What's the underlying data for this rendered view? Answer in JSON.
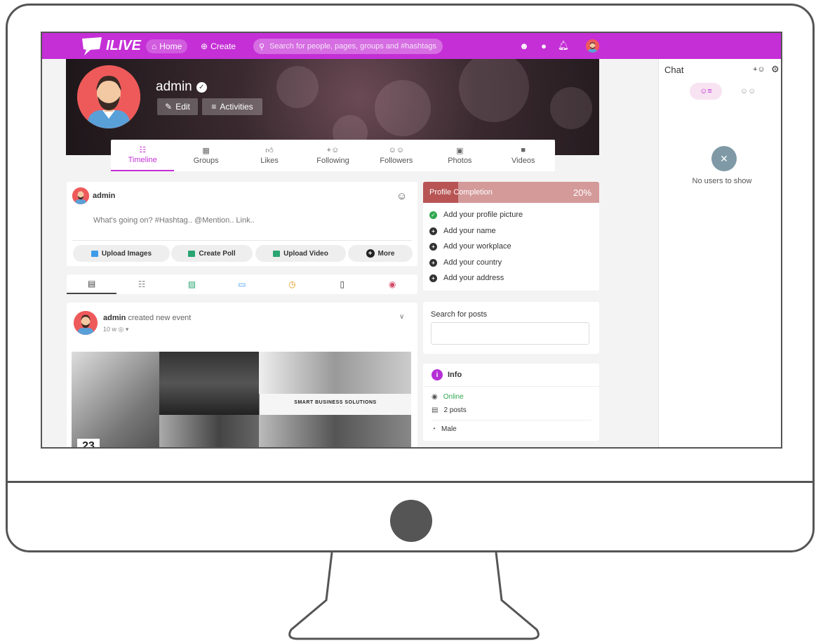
{
  "topbar": {
    "logo": "ILIVE",
    "home_label": "Home",
    "create_label": "Create",
    "search_placeholder": "Search for people, pages, groups and #hashtags"
  },
  "profile": {
    "name": "admin",
    "edit_label": "Edit",
    "activities_label": "Activities"
  },
  "tabs": [
    {
      "label": "Timeline",
      "icon": "timeline-icon"
    },
    {
      "label": "Groups",
      "icon": "groups-icon"
    },
    {
      "label": "Likes",
      "icon": "thumbs-up-icon"
    },
    {
      "label": "Following",
      "icon": "user-plus-icon"
    },
    {
      "label": "Followers",
      "icon": "users-icon"
    },
    {
      "label": "Photos",
      "icon": "image-icon"
    },
    {
      "label": "Videos",
      "icon": "video-icon"
    }
  ],
  "publisher": {
    "user": "admin",
    "placeholder": "What's going on? #Hashtag.. @Mention.. Link..",
    "upload_images": "Upload Images",
    "create_poll": "Create Poll",
    "upload_video": "Upload Video",
    "more": "More"
  },
  "post": {
    "author": "admin",
    "action": "created new event",
    "time": "10 w",
    "image_title": "SMART BUSINESS SOLUTIONS",
    "date_day": "23"
  },
  "completion": {
    "title": "Profile Completion",
    "percent": "20%",
    "progress": 0.2,
    "items": [
      {
        "label": "Add your profile picture",
        "done": true
      },
      {
        "label": "Add your name",
        "done": false
      },
      {
        "label": "Add your workplace",
        "done": false
      },
      {
        "label": "Add your country",
        "done": false
      },
      {
        "label": "Add your address",
        "done": false
      }
    ]
  },
  "search_posts": {
    "label": "Search for posts"
  },
  "info": {
    "title": "Info",
    "status": "Online",
    "posts": "2 posts",
    "gender": "Male"
  },
  "chat": {
    "title": "Chat",
    "empty": "No users to show"
  },
  "colors": {
    "brand": "#c42fd6",
    "online": "#2fa84f",
    "completion_fill": "#b85454"
  }
}
